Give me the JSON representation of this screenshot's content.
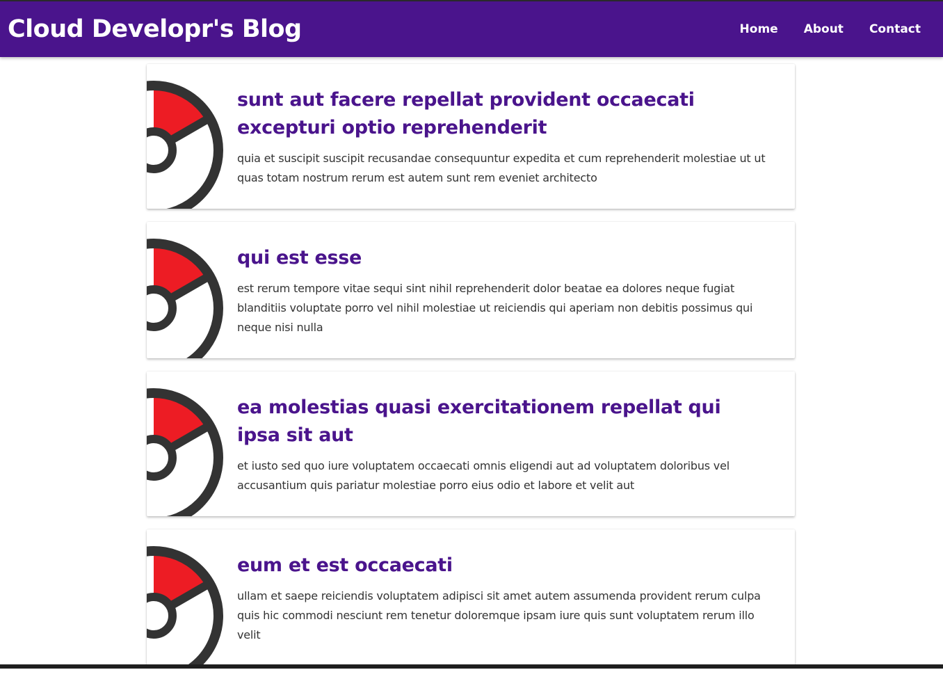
{
  "header": {
    "brand": "Cloud Developr's Blog",
    "nav": [
      {
        "label": "Home"
      },
      {
        "label": "About"
      },
      {
        "label": "Contact"
      }
    ]
  },
  "colors": {
    "primary": "#4a148c",
    "thumb_red": "#ed1c24",
    "thumb_dark": "#333333"
  },
  "posts": [
    {
      "title": "sunt aut facere repellat provident occaecati excepturi optio reprehenderit",
      "body": "quia et suscipit suscipit recusandae consequuntur expedita et cum reprehenderit molestiae ut ut quas totam nostrum rerum est autem sunt rem eveniet architecto",
      "icon": "pokeball-icon"
    },
    {
      "title": "qui est esse",
      "body": "est rerum tempore vitae sequi sint nihil reprehenderit dolor beatae ea dolores neque fugiat blanditiis voluptate porro vel nihil molestiae ut reiciendis qui aperiam non debitis possimus qui neque nisi nulla",
      "icon": "pokeball-icon"
    },
    {
      "title": "ea molestias quasi exercitationem repellat qui ipsa sit aut",
      "body": "et iusto sed quo iure voluptatem occaecati omnis eligendi aut ad voluptatem doloribus vel accusantium quis pariatur molestiae porro eius odio et labore et velit aut",
      "icon": "pokeball-icon"
    },
    {
      "title": "eum et est occaecati",
      "body": "ullam et saepe reiciendis voluptatem adipisci sit amet autem assumenda provident rerum culpa quis hic commodi nesciunt rem tenetur doloremque ipsam iure quis sunt voluptatem rerum illo velit",
      "icon": "pokeball-icon"
    }
  ]
}
